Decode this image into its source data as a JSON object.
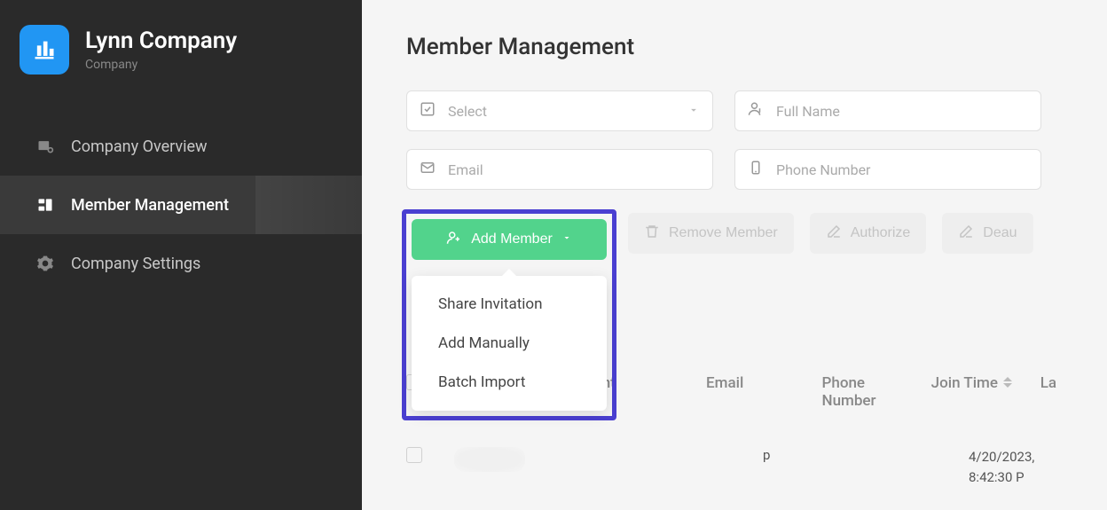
{
  "sidebar": {
    "company_name": "Lynn Company",
    "company_subtitle": "Company",
    "items": [
      {
        "label": "Company Overview"
      },
      {
        "label": "Member Management"
      },
      {
        "label": "Company Settings"
      }
    ]
  },
  "main": {
    "title": "Member Management",
    "filters": {
      "select_placeholder": "Select",
      "name_placeholder": "Full Name",
      "email_placeholder": "Email",
      "phone_placeholder": "Phone Number"
    },
    "actions": {
      "add_member": "Add Member",
      "remove_member": "Remove Member",
      "authorize": "Authorize",
      "deauthorize": "Deau"
    },
    "add_member_menu": [
      "Share Invitation",
      "Add Manually",
      "Batch Import"
    ],
    "table": {
      "headers": {
        "account": "Account",
        "email": "Email",
        "phone": "Phone Number",
        "join": "Join Time",
        "last": "La"
      },
      "rows": [
        {
          "email_partial": "p",
          "join_time": "4/20/2023, 8:42:30 P"
        }
      ]
    }
  }
}
